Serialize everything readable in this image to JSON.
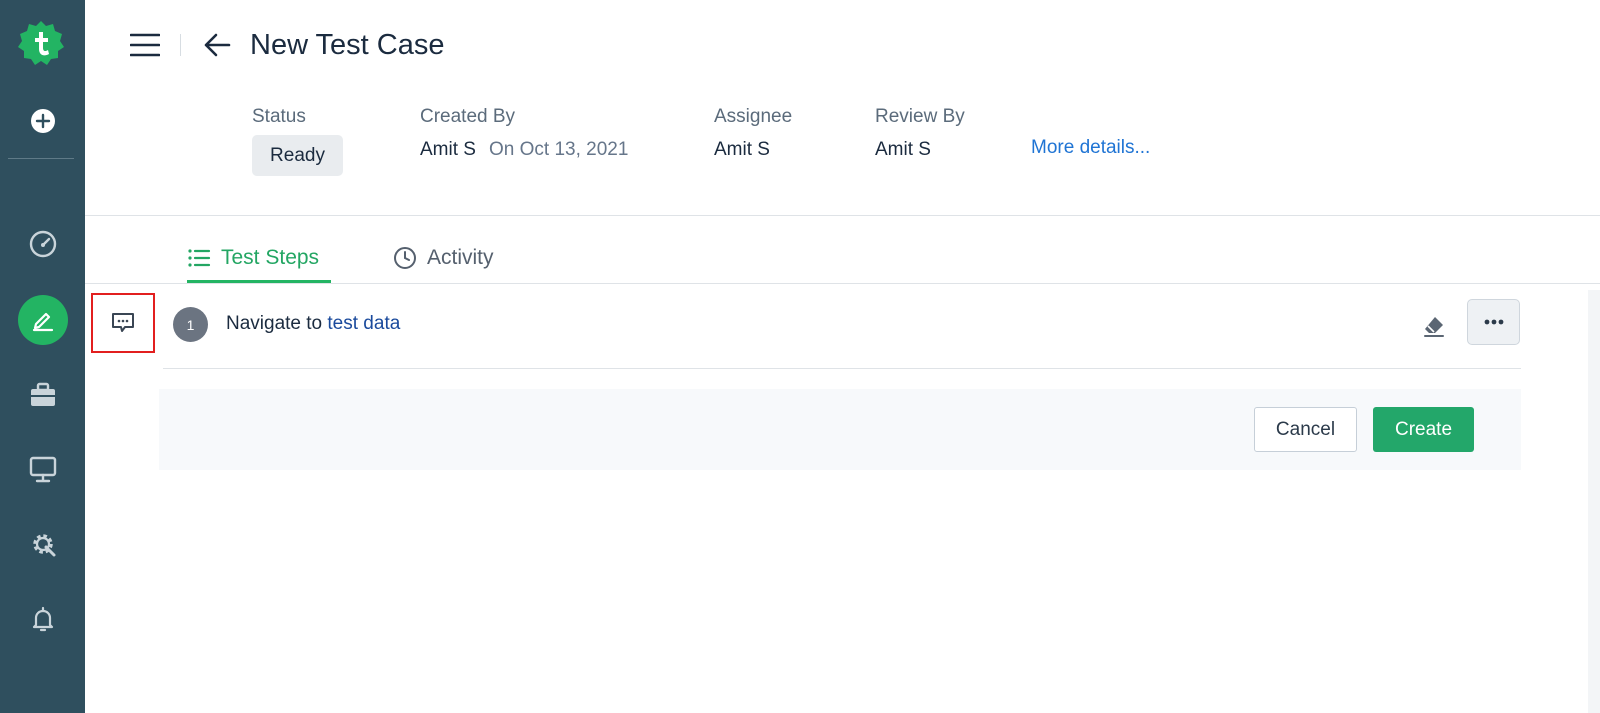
{
  "header": {
    "title": "New Test Case"
  },
  "details": {
    "status_label": "Status",
    "status_value": "Ready",
    "created_by_label": "Created By",
    "created_by_value": "Amit S",
    "created_on": "On Oct 13, 2021",
    "assignee_label": "Assignee",
    "assignee_value": "Amit S",
    "review_by_label": "Review By",
    "review_by_value": "Amit S",
    "more_link": "More details..."
  },
  "tabs": [
    {
      "label": "Test Steps",
      "icon": "list-icon",
      "active": true
    },
    {
      "label": "Activity",
      "icon": "clock-icon",
      "active": false
    }
  ],
  "steps": [
    {
      "number": "1",
      "text": "Navigate to",
      "link": "test data"
    }
  ],
  "actions": {
    "cancel_label": "Cancel",
    "create_label": "Create"
  },
  "sidebar": {
    "items": [
      {
        "icon": "logo-icon"
      },
      {
        "icon": "plus-circle-icon"
      },
      {
        "icon": "dashboard-icon"
      },
      {
        "icon": "edit-icon",
        "active": true
      },
      {
        "icon": "briefcase-icon"
      },
      {
        "icon": "monitor-icon"
      },
      {
        "icon": "settings-icon"
      },
      {
        "icon": "bell-icon"
      }
    ]
  },
  "colors": {
    "sidebar_bg": "#2f4f5e",
    "accent_green": "#23b463",
    "link_blue": "#1f74d4",
    "highlight_red": "#e21f1f"
  }
}
